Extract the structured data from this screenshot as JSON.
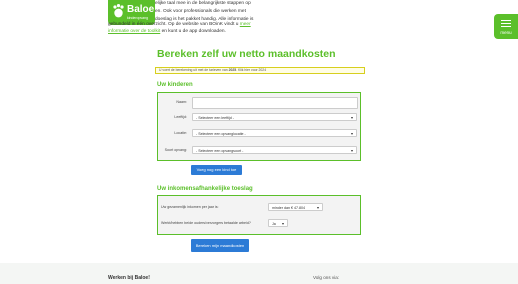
{
  "brand": {
    "name": "Baloe",
    "sub": "kinderopvang"
  },
  "intro": {
    "line1": "elijke taal mee in de belangrijkste stappen op",
    "line2": "en. Ook voor professionals die werken met",
    "line3": "doeslag is het pakket handig. Alle informatie is",
    "line4_text": "gebundeld in één overzicht. Op de website van BOinK vindt u",
    "line4_link": "meer",
    "line5_link": "informatie over de toolkit",
    "line5_text": "en kunt u de app downloaden."
  },
  "menu": {
    "label": "menu"
  },
  "page": {
    "title": "Bereken zelf uw netto maandkosten",
    "notice_pre": "U voert de berekening uit met de tarieven van",
    "notice_year": "2025",
    "notice_post": "Klik hier voor 2024"
  },
  "children_section": {
    "title": "Uw kinderen",
    "name_label": "Naam:",
    "age_label": "Leeftijd:",
    "location_label": "Locatie:",
    "care_label": "Soort opvang:",
    "name_value": "",
    "age_value": "- Selecteer een leeftijd -",
    "location_value": "- Selecteer een opvanglocatie -",
    "care_value": "- Selecteer een opvangsoort -",
    "add_button": "Voeg nog een kind toe"
  },
  "income_section": {
    "title": "Uw inkomensafhankelijke toeslag",
    "income_label": "Uw gezamenlijk inkomen per jaar is:",
    "income_value": "minder dan € 47.804",
    "work_label": "Werkt/hebben beide ouders/verzorgers betaalde arbeid?",
    "work_value": "Ja",
    "calc_button": "Bereken mijn maandkosten"
  },
  "footer": {
    "work_title": "Werken bij Baloe!",
    "follow_title": "Volg ons via:"
  },
  "colors": {
    "brand_green": "#5bbf2a",
    "button_blue": "#2c7bd6",
    "notice_border": "#d7cf1e"
  }
}
